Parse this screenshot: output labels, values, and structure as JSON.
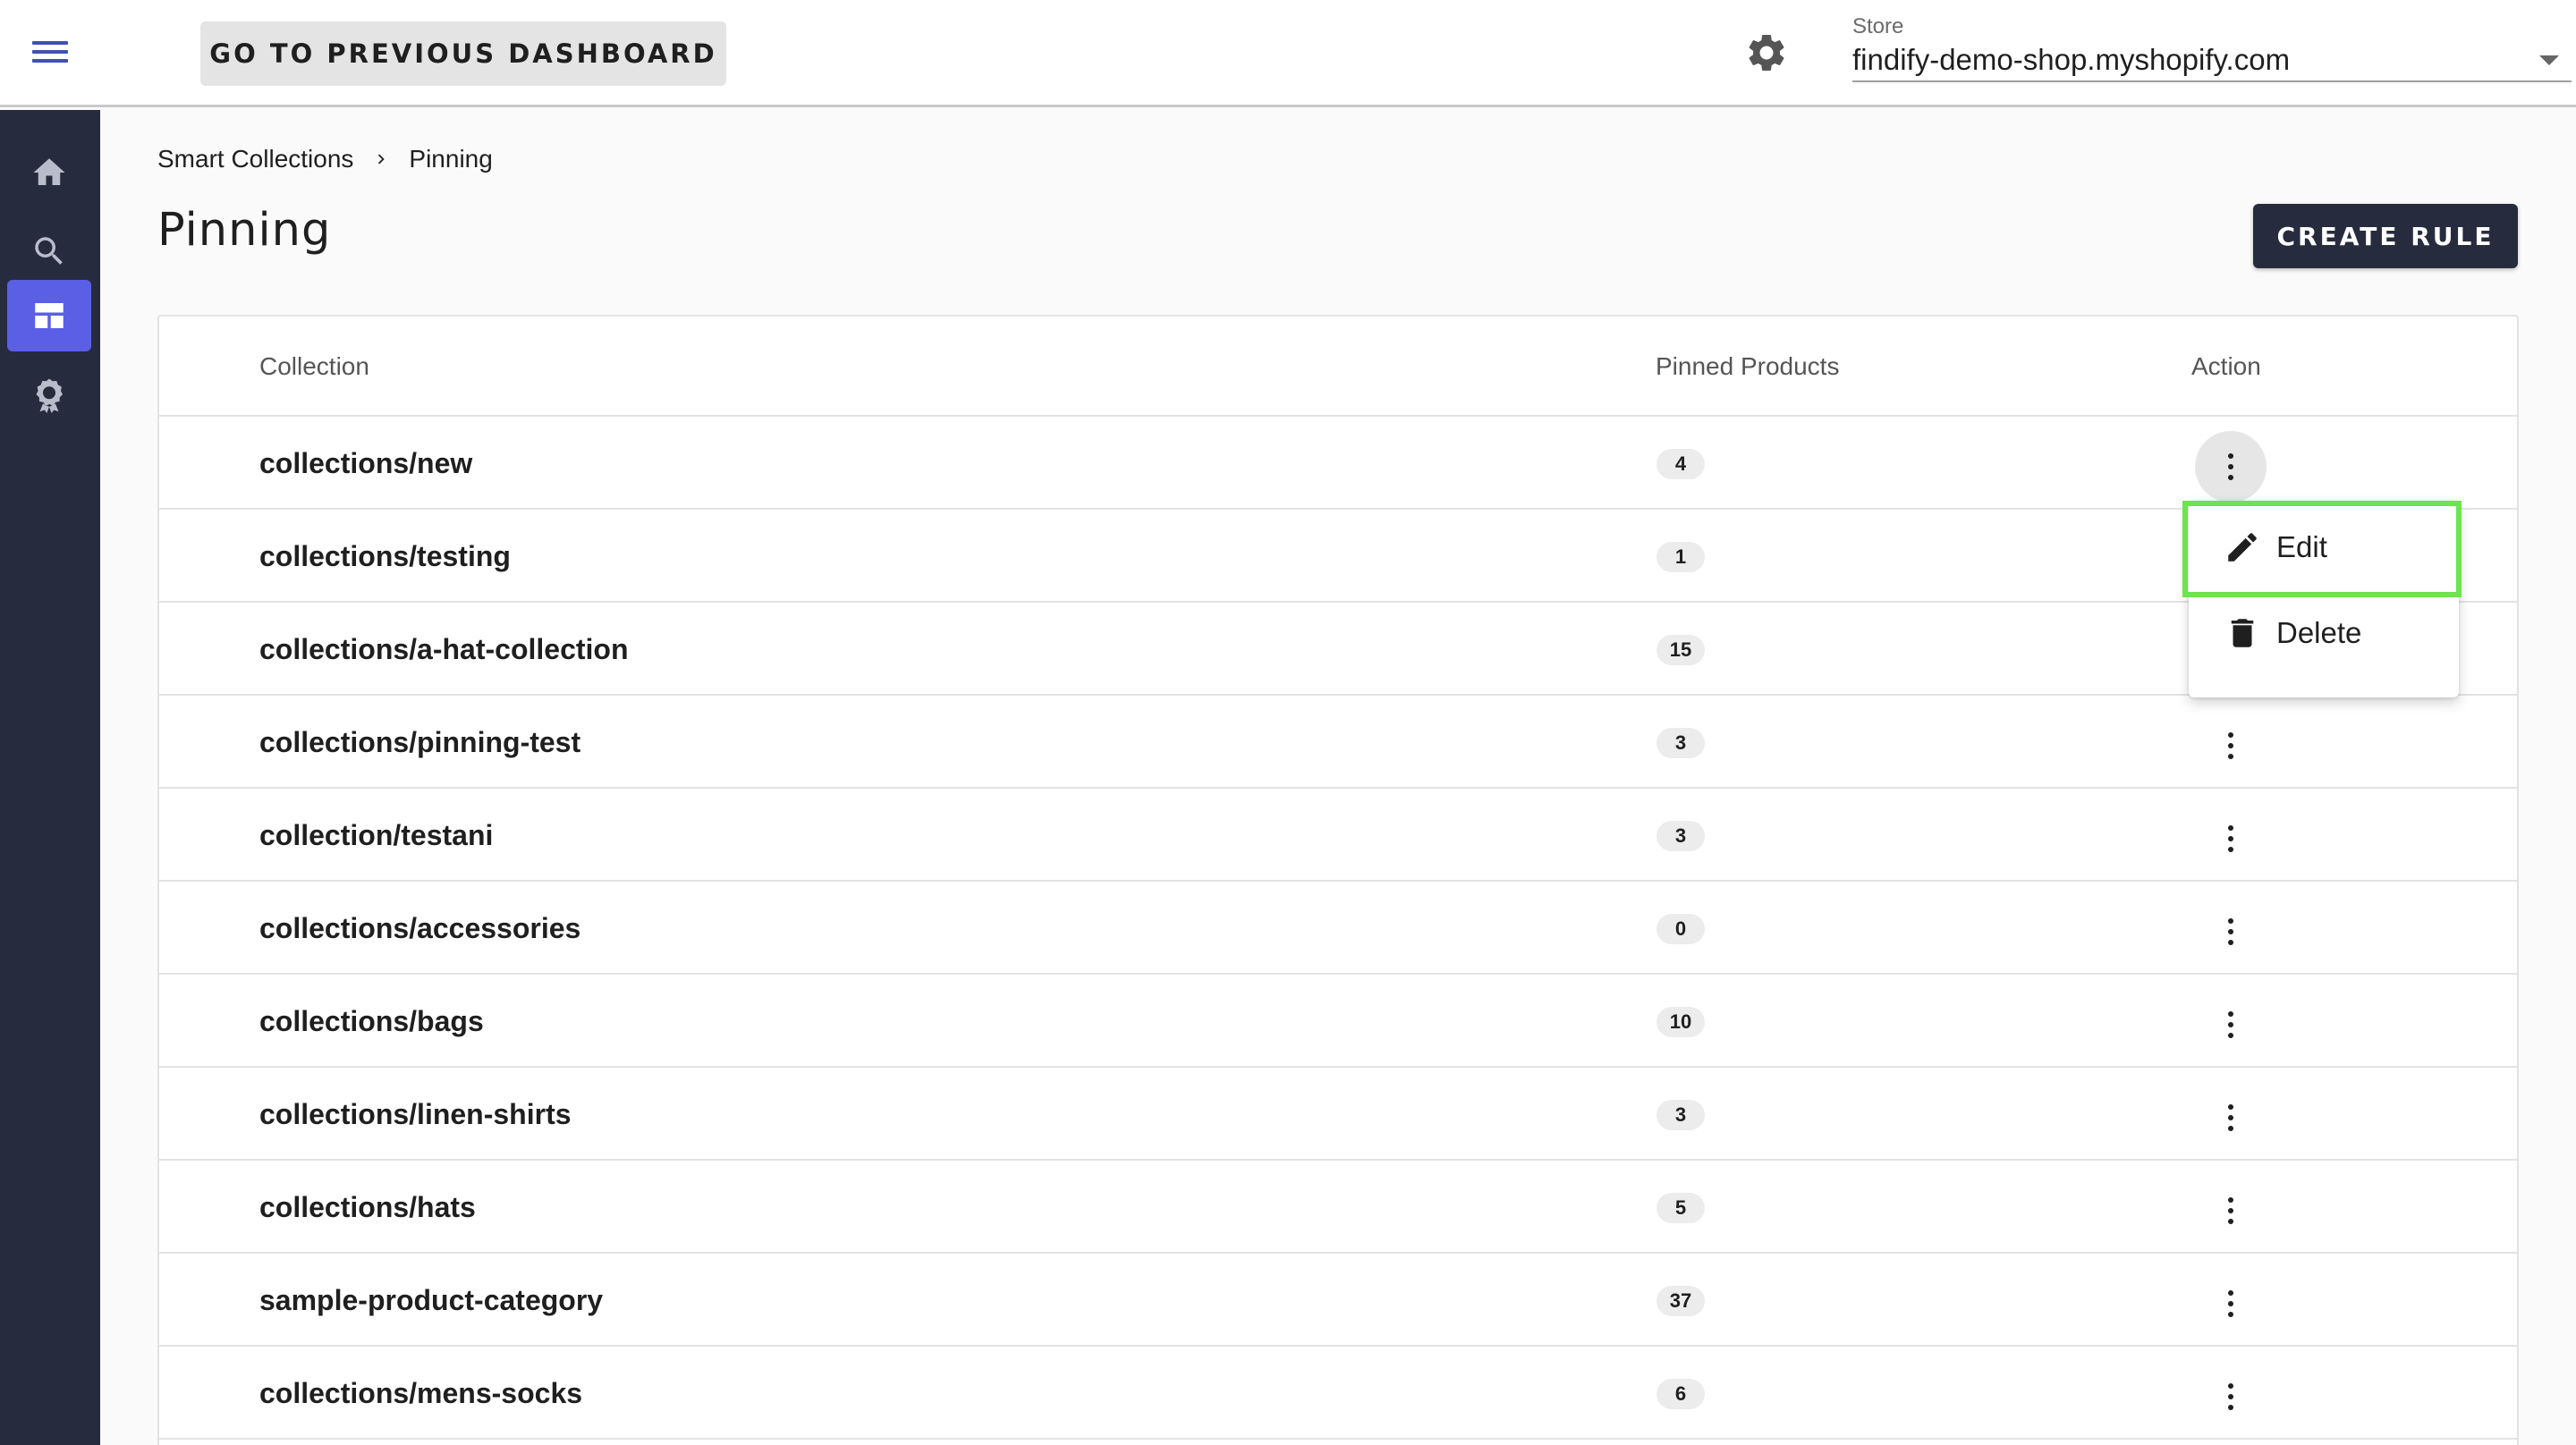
{
  "topbar": {
    "prev_dashboard_label": "GO TO PREVIOUS DASHBOARD",
    "store_label": "Store",
    "store_value": "findify-demo-shop.myshopify.com"
  },
  "sidebar": {
    "items": [
      {
        "name": "home-icon",
        "active": false
      },
      {
        "name": "search-icon",
        "active": false
      },
      {
        "name": "smart-collections-icon",
        "active": true
      },
      {
        "name": "merchandising-icon",
        "active": false
      }
    ],
    "active_color": "#5a5fe6",
    "background": "#262c3d"
  },
  "breadcrumb": {
    "items": [
      "Smart Collections",
      "Pinning"
    ]
  },
  "page": {
    "title": "Pinning",
    "create_label": "CREATE RULE"
  },
  "table": {
    "headers": {
      "collection": "Collection",
      "pinned": "Pinned Products",
      "action": "Action"
    },
    "rows": [
      {
        "collection": "collections/new",
        "pinned": "4"
      },
      {
        "collection": "collections/testing",
        "pinned": "1"
      },
      {
        "collection": "collections/a-hat-collection",
        "pinned": "15"
      },
      {
        "collection": "collections/pinning-test",
        "pinned": "3"
      },
      {
        "collection": "collection/testani",
        "pinned": "3"
      },
      {
        "collection": "collections/accessories",
        "pinned": "0"
      },
      {
        "collection": "collections/bags",
        "pinned": "10"
      },
      {
        "collection": "collections/linen-shirts",
        "pinned": "3"
      },
      {
        "collection": "collections/hats",
        "pinned": "5"
      },
      {
        "collection": "sample-product-category",
        "pinned": "37"
      },
      {
        "collection": "collections/mens-socks",
        "pinned": "6"
      }
    ]
  },
  "action_menu": {
    "edit_label": "Edit",
    "delete_label": "Delete",
    "highlight_color": "#6de34f"
  }
}
